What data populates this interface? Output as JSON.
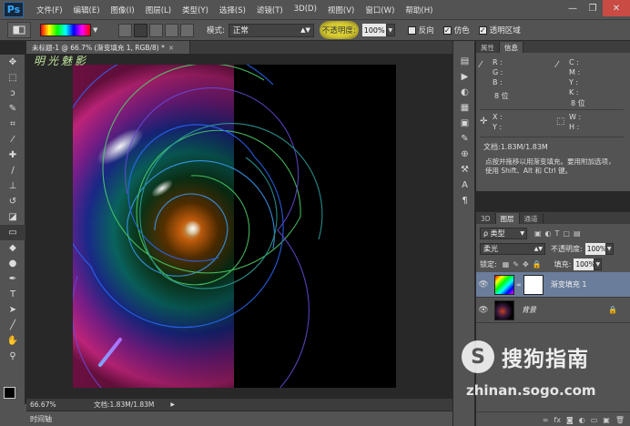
{
  "app": {
    "logo": "Ps"
  },
  "menu": [
    "文件(F)",
    "编辑(E)",
    "图像(I)",
    "图层(L)",
    "类型(Y)",
    "选择(S)",
    "滤镜(T)",
    "3D(D)",
    "视图(V)",
    "窗口(W)",
    "帮助(H)"
  ],
  "window_controls": {
    "minimize": "—",
    "restore": "❐",
    "close": "✕"
  },
  "options": {
    "mode_label": "模式:",
    "mode_value": "正常",
    "opacity_label": "不透明度:",
    "opacity_value": "100%",
    "reverse_label": "反向",
    "dither_label": "仿色",
    "transparency_label": "透明区域",
    "check_mark": "✓"
  },
  "document": {
    "tab_title": "未标题-1 @ 66.7% (渐变填充 1, RGB/8) *",
    "tab_close": "×",
    "watermark_title": "明光魅影",
    "zoom": "66.67%",
    "doc_size": "文档:1.83M/1.83M",
    "status_arrow": "▶"
  },
  "timeline": {
    "label": "时间轴"
  },
  "info_panel": {
    "tabs": [
      "属性",
      "信息"
    ],
    "active_tab": "信息",
    "rgb_labels": [
      "R :",
      "G :",
      "B :"
    ],
    "cmyk_labels": [
      "C :",
      "M :",
      "Y :",
      "K :"
    ],
    "bit_left": "8 位",
    "bit_right": "8 位",
    "xy_labels": [
      "X :",
      "Y :"
    ],
    "wh_labels": [
      "W :",
      "H :"
    ],
    "doc_size": "文档:1.83M/1.83M",
    "description": "点按并拖移以用渐变填充。要用附加选项，使用 Shift、Alt 和 Ctrl 键。"
  },
  "layers_panel": {
    "tabs": [
      "3D",
      "图层",
      "通道"
    ],
    "active_tab": "图层",
    "filter_label": "ρ 类型",
    "blend_mode": "柔光",
    "opacity_label": "不透明度:",
    "opacity_value": "100%",
    "lock_label": "锁定:",
    "fill_label": "填充:",
    "fill_value": "100%",
    "layers": [
      {
        "name": "渐变填充 1",
        "selected": true
      },
      {
        "name": "背景",
        "selected": false
      }
    ]
  },
  "tools": [
    {
      "name": "move-tool-icon",
      "glyph": "✥"
    },
    {
      "name": "marquee-tool-icon",
      "glyph": "⬚"
    },
    {
      "name": "lasso-tool-icon",
      "glyph": "ↄ"
    },
    {
      "name": "quick-select-tool-icon",
      "glyph": "✎"
    },
    {
      "name": "crop-tool-icon",
      "glyph": "⌗"
    },
    {
      "name": "eyedropper-tool-icon",
      "glyph": "⁄"
    },
    {
      "name": "healing-brush-tool-icon",
      "glyph": "✚"
    },
    {
      "name": "brush-tool-icon",
      "glyph": "∕"
    },
    {
      "name": "clone-stamp-tool-icon",
      "glyph": "⊥"
    },
    {
      "name": "history-brush-tool-icon",
      "glyph": "↺"
    },
    {
      "name": "eraser-tool-icon",
      "glyph": "◪"
    },
    {
      "name": "gradient-tool-icon",
      "glyph": "▭"
    },
    {
      "name": "blur-tool-icon",
      "glyph": "◆"
    },
    {
      "name": "dodge-tool-icon",
      "glyph": "●"
    },
    {
      "name": "pen-tool-icon",
      "glyph": "✒"
    },
    {
      "name": "type-tool-icon",
      "glyph": "T"
    },
    {
      "name": "path-select-tool-icon",
      "glyph": "➤"
    },
    {
      "name": "shape-tool-icon",
      "glyph": "╱"
    },
    {
      "name": "hand-tool-icon",
      "glyph": "✋"
    },
    {
      "name": "zoom-tool-icon",
      "glyph": "⚲"
    }
  ],
  "panel_icons": [
    {
      "name": "history-panel-icon",
      "glyph": "▤"
    },
    {
      "name": "actions-panel-icon",
      "glyph": "▶"
    },
    {
      "name": "adjustments-panel-icon",
      "glyph": "◐"
    },
    {
      "name": "swatches-panel-icon",
      "glyph": "▦"
    },
    {
      "name": "styles-panel-icon",
      "glyph": "▣"
    },
    {
      "name": "brush-panel-icon",
      "glyph": "✎"
    },
    {
      "name": "clone-source-panel-icon",
      "glyph": "⊕"
    },
    {
      "name": "tool-presets-panel-icon",
      "glyph": "⚒"
    },
    {
      "name": "character-panel-icon",
      "glyph": "A"
    },
    {
      "name": "paragraph-panel-icon",
      "glyph": "¶"
    }
  ],
  "watermark": {
    "logo_glyph": "S",
    "brand": "搜狗指南",
    "url": "zhinan.sogo.com"
  }
}
